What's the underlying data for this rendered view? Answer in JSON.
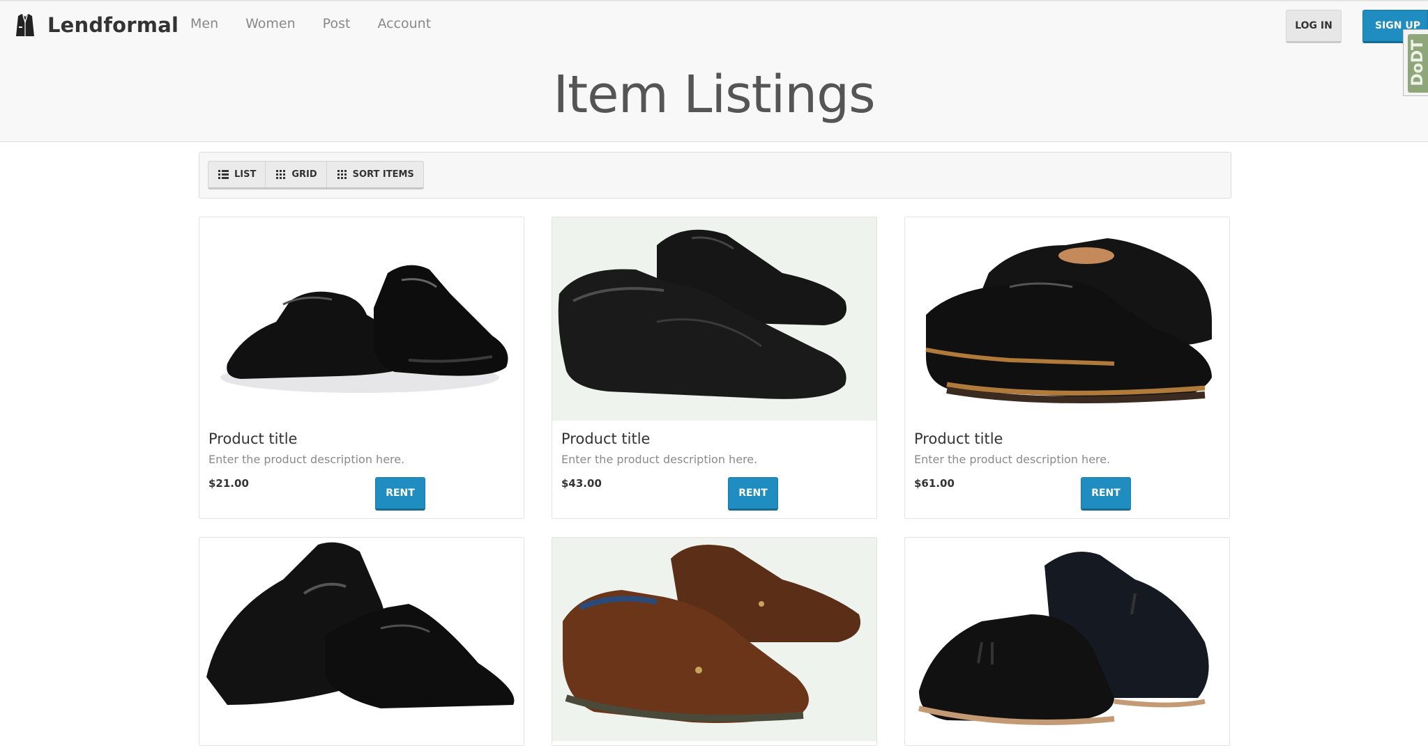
{
  "brand": {
    "name": "Lendformal",
    "logo_icon": "jacket-icon"
  },
  "nav": {
    "items": [
      {
        "label": "Men"
      },
      {
        "label": "Women"
      },
      {
        "label": "Post"
      },
      {
        "label": "Account"
      }
    ]
  },
  "auth": {
    "login_label": "LOG IN",
    "signup_label": "SIGN UP"
  },
  "extension_badge": {
    "text": "DoDT"
  },
  "page": {
    "title": "Item Listings"
  },
  "toolbar": {
    "buttons": [
      {
        "label": "LIST",
        "icon": "list-icon"
      },
      {
        "label": "GRID",
        "icon": "grid-icon"
      },
      {
        "label": "SORT ITEMS",
        "icon": "grid-icon"
      }
    ]
  },
  "products": [
    {
      "title": "Product title",
      "description": "Enter the product description here.",
      "price": "$21.00",
      "action": "RENT",
      "image": "black-lace-up-derby-shoes"
    },
    {
      "title": "Product title",
      "description": "Enter the product description here.",
      "price": "$43.00",
      "action": "RENT",
      "image": "black-leather-moc-toe-shoes"
    },
    {
      "title": "Product title",
      "description": "Enter the product description here.",
      "price": "$61.00",
      "action": "RENT",
      "image": "black-cap-toe-oxford-shoes"
    },
    {
      "title": "",
      "description": "",
      "price": "",
      "action": "",
      "image": "black-slip-on-loafers"
    },
    {
      "title": "",
      "description": "",
      "price": "",
      "action": "",
      "image": "brown-boat-shoes"
    },
    {
      "title": "",
      "description": "",
      "price": "",
      "action": "",
      "image": "black-tassel-loafers"
    }
  ],
  "colors": {
    "accent": "#1f8dbf",
    "header_bg": "#f8f8f8",
    "title": "#555555"
  }
}
